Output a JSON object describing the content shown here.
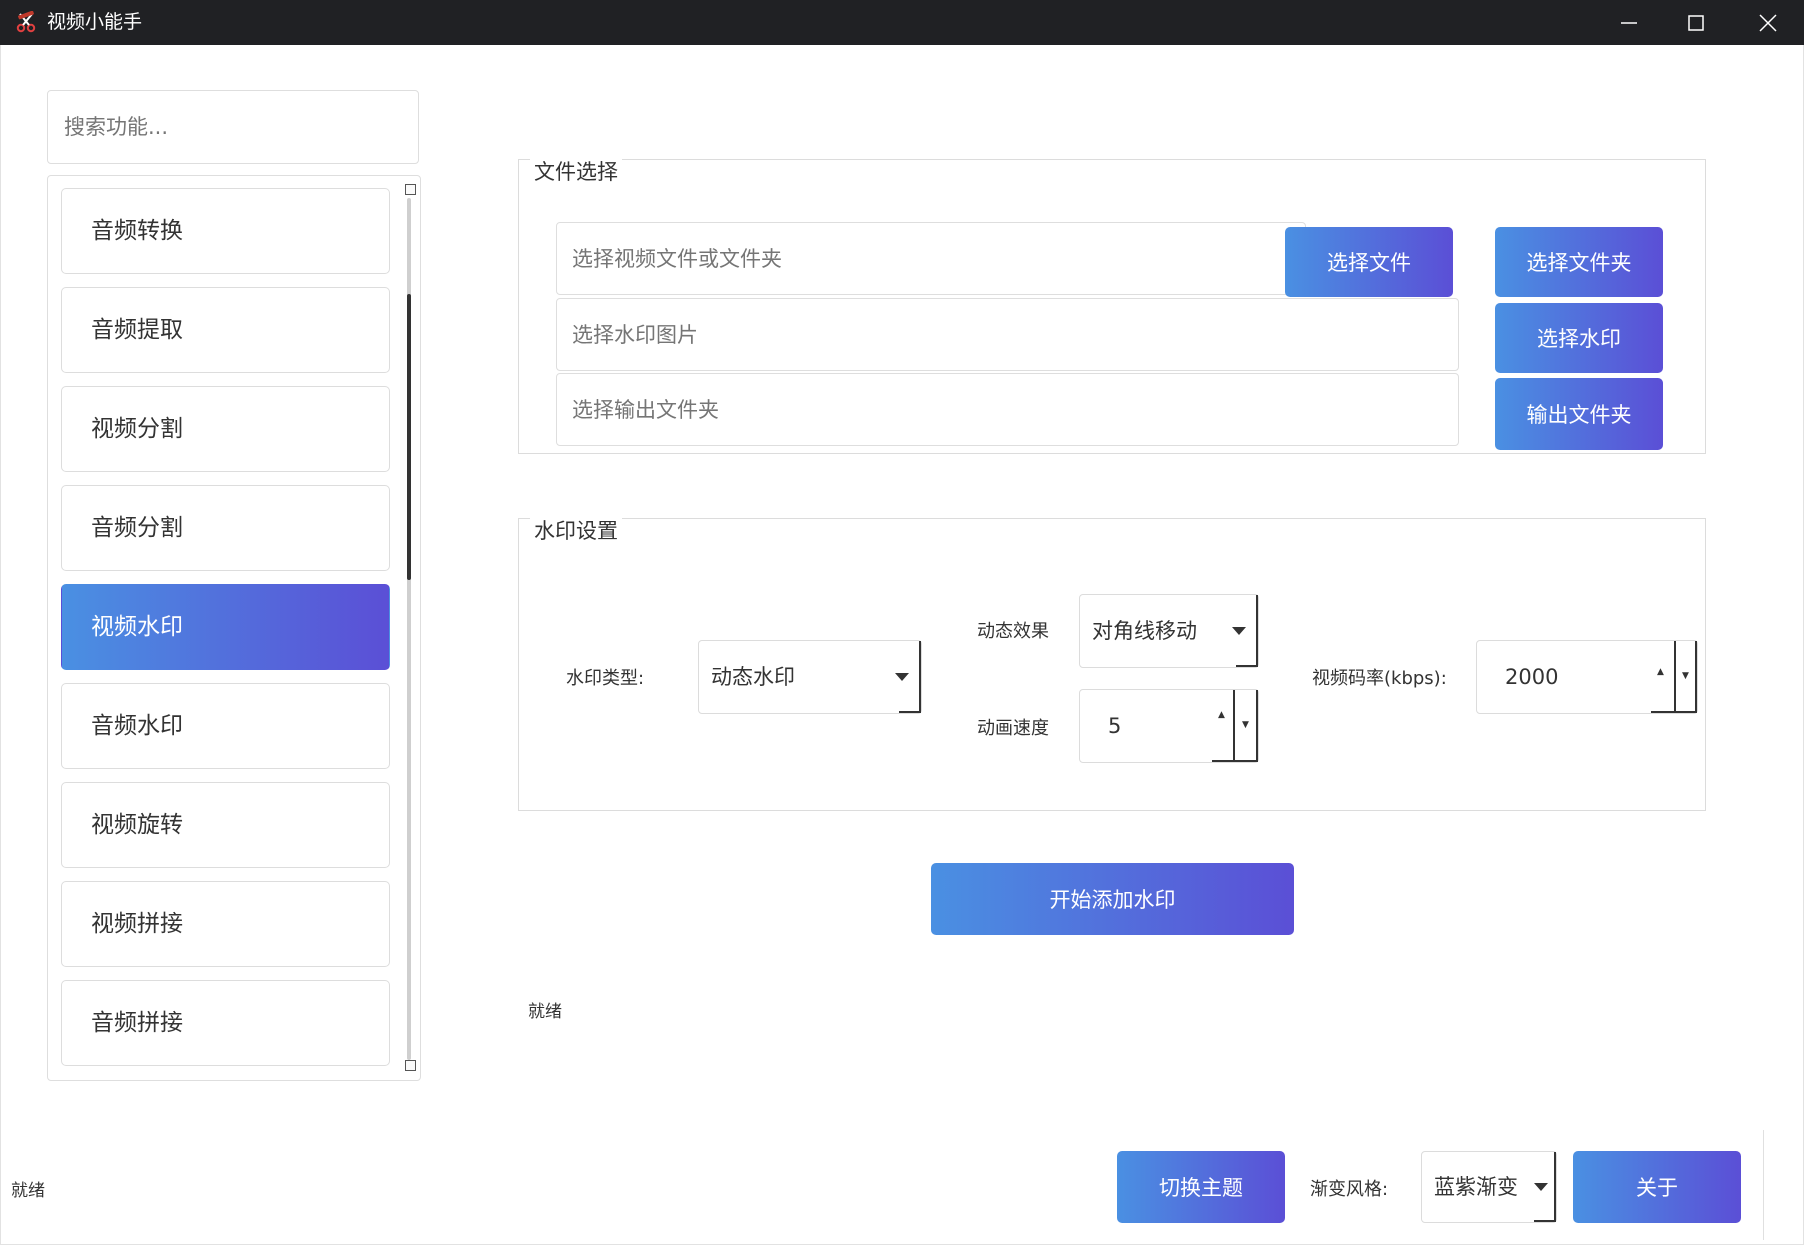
{
  "window": {
    "title": "视频小能手",
    "icon": "scissors-icon",
    "controls": [
      "minimize-icon",
      "maximize-icon",
      "close-icon"
    ]
  },
  "sidebar": {
    "search_placeholder": "搜索功能...",
    "items": [
      {
        "label": "音频转换",
        "active": false
      },
      {
        "label": "音频提取",
        "active": false
      },
      {
        "label": "视频分割",
        "active": false
      },
      {
        "label": "音频分割",
        "active": false
      },
      {
        "label": "视频水印",
        "active": true
      },
      {
        "label": "音频水印",
        "active": false
      },
      {
        "label": "视频旋转",
        "active": false
      },
      {
        "label": "视频拼接",
        "active": false
      },
      {
        "label": "音频拼接",
        "active": false
      }
    ]
  },
  "file_section": {
    "title": "文件选择",
    "video_placeholder": "选择视频文件或文件夹",
    "select_file_label": "选择文件",
    "select_folder_label": "选择文件夹",
    "watermark_placeholder": "选择水印图片",
    "select_watermark_label": "选择水印",
    "output_placeholder": "选择输出文件夹",
    "output_folder_label": "输出文件夹"
  },
  "watermark_section": {
    "title": "水印设置",
    "type_label": "水印类型:",
    "type_value": "动态水印",
    "effect_label": "动态效果",
    "effect_value": "对角线移动",
    "speed_label": "动画速度",
    "speed_value": "5",
    "bitrate_label": "视频码率(kbps):",
    "bitrate_value": "2000"
  },
  "actions": {
    "start_label": "开始添加水印",
    "status_text": "就绪"
  },
  "footer": {
    "status_text": "就绪",
    "theme_button": "切换主题",
    "gradient_label": "渐变风格:",
    "gradient_value": "蓝紫渐变",
    "about_button": "关于"
  },
  "colors": {
    "titlebar": "#202124",
    "gradient_start": "#4a90e2",
    "gradient_end": "#5b4fd6"
  }
}
